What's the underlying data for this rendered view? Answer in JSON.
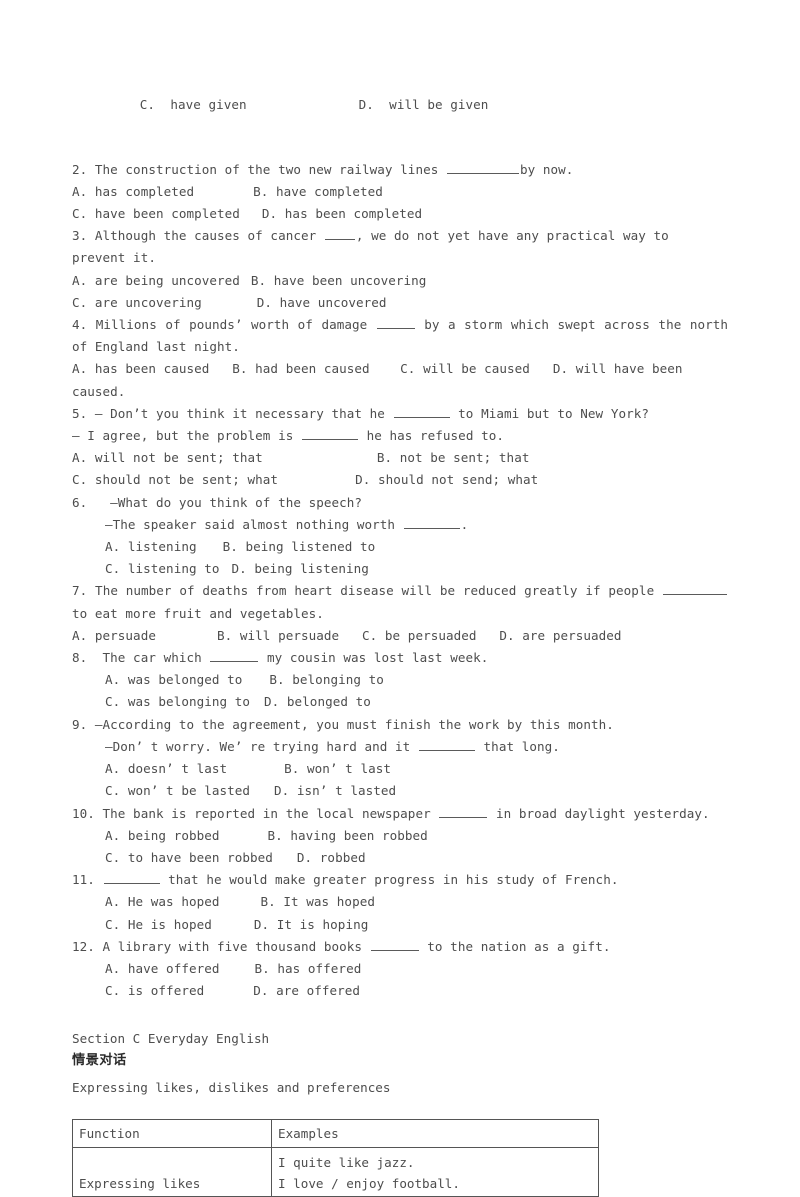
{
  "document": {
    "carryover_options": {
      "c": "C.  have given",
      "d": "D.  will be given"
    },
    "questions": [
      {
        "number": "2.",
        "stem_pre": "2. The construction of the two new railway lines ",
        "stem_post": "by now.",
        "options_line1_a": "A. has completed",
        "options_line1_b": "B. have completed",
        "options_line2_c": "C. have been completed",
        "options_line2_d": "D. has been completed"
      },
      {
        "number": "3.",
        "stem_pre": "3. Although the causes of cancer ",
        "stem_post": ", we do not yet have any practical way to prevent it.",
        "options_line1_a": "A. are being uncovered",
        "options_line1_b": "B. have been uncovering",
        "options_line2_c": "C. are uncovering",
        "options_line2_d": "D. have uncovered"
      },
      {
        "number": "4.",
        "stem_pre": "4. Millions of pounds’ worth of damage ",
        "stem_post": " by a storm which swept across the north of England last night.",
        "options_line1": "A. has been caused   B. had been caused    C. will be caused   D. will have been caused."
      },
      {
        "number": "5.",
        "stem_pre": "5. — Don’t you think it necessary that he ",
        "stem_post": " to Miami but to New York?",
        "stem2_pre": "— I agree, but the problem is ",
        "stem2_post": " he has refused to.",
        "options_line1_a": "A. will not be sent; that",
        "options_line1_b": "B. not be sent; that",
        "options_line2_c": "C. should not be sent; what",
        "options_line2_d": "D. should not send; what"
      },
      {
        "number": "6.",
        "stem_pre": "6.   —What do you think of the speech?",
        "stem2_pre": "—The speaker said almost nothing worth ",
        "stem2_post": ".",
        "options_line1_a": "A. listening",
        "options_line1_b": "B. being listened to",
        "options_line2_c": "C. listening to",
        "options_line2_d": "D. being listening"
      },
      {
        "number": "7.",
        "stem_pre": "7. The number of deaths from heart disease will be reduced greatly if people ",
        "stem_post": "to eat more fruit and vegetables.",
        "options_line1": "A. persuade        B. will persuade   C. be persuaded   D. are persuaded"
      },
      {
        "number": "8.",
        "stem_pre": "8.  The car which ",
        "stem_post": " my cousin was lost last week.",
        "options_line1_a": "A. was belonged to",
        "options_line1_b": "B. belonging to",
        "options_line2_c": "C. was belonging to",
        "options_line2_d": "D. belonged to"
      },
      {
        "number": "9.",
        "stem_pre": "9. —According to the agreement, you must finish the work by this month.",
        "stem2_pre": "—Don’ t worry. We’ re trying hard and it ",
        "stem2_post": " that long.",
        "options_line1_a": "A. doesn’ t last",
        "options_line1_b": "B. won’ t last",
        "options_line2_c": "C. won’ t be lasted",
        "options_line2_d": "D. isn’ t lasted"
      },
      {
        "number": "10.",
        "stem_pre": "10. The bank is reported in the local newspaper ",
        "stem_post": " in broad daylight yesterday.",
        "options_line1_a": "A. being robbed",
        "options_line1_b": "B. having been robbed",
        "options_line2_c": "C. to have been robbed",
        "options_line2_d": "D. robbed"
      },
      {
        "number": "11.",
        "stem_pre": "11. ",
        "stem_post": " that he would make greater progress in his study of French.",
        "options_line1_a": "A. He was hoped",
        "options_line1_b": "B. It was hoped",
        "options_line2_c": "C. He is hoped",
        "options_line2_d": "D. It is hoping"
      },
      {
        "number": "12.",
        "stem_pre": "12. A library with five thousand books ",
        "stem_post": " to the nation as a gift.",
        "options_line1_a": "A. have offered",
        "options_line1_b": "B. has offered",
        "options_line2_c": "C. is offered",
        "options_line2_d": "D. are offered"
      }
    ],
    "section_c": {
      "heading": "Section C Everyday English",
      "chinese_heading": "情景对话",
      "subheading": "Expressing likes, dislikes and preferences",
      "table": {
        "headers": [
          "Function",
          "Examples"
        ],
        "rows": [
          {
            "function": "Expressing likes",
            "examples": "I quite like jazz.\nI love / enjoy football."
          }
        ]
      }
    }
  }
}
